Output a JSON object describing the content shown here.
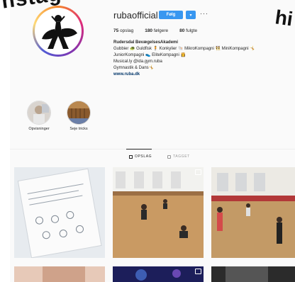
{
  "overlay": {
    "left_text": "nstag",
    "right_text": "hi"
  },
  "profile": {
    "username": "rubaofficial",
    "follow_label": "Følg",
    "dropdown_label": "▾",
    "more_label": "···"
  },
  "stats": {
    "posts_count": "75",
    "posts_label": "opslag",
    "followers_count": "180",
    "followers_label": "følgere",
    "following_count": "80",
    "following_label": "fulgte"
  },
  "bio": {
    "name": "Rudersdal BevægelsesAkademi",
    "line1": "Gubbier 🐢 Guldfisk 🧍 Konkylier 🐚 MikroKompagni 👯 MiniKompagni 🤸",
    "line2": "JuniorKompagni 👟 EliteKompagni 👸",
    "line3": "Musical.ly @ida.gym.ruba",
    "line4": "Gymnastik & Dans🤸",
    "website": "www.ruba.dk"
  },
  "highlights": [
    {
      "label": "Opvisninger"
    },
    {
      "label": "Seje tricks"
    }
  ],
  "tabs": {
    "posts_label": "OPSLAG",
    "tagged_label": "TAGGET"
  },
  "colors": {
    "primary_button": "#3897f0",
    "text": "#262626",
    "link": "#003569",
    "border": "#dbdbdb"
  }
}
